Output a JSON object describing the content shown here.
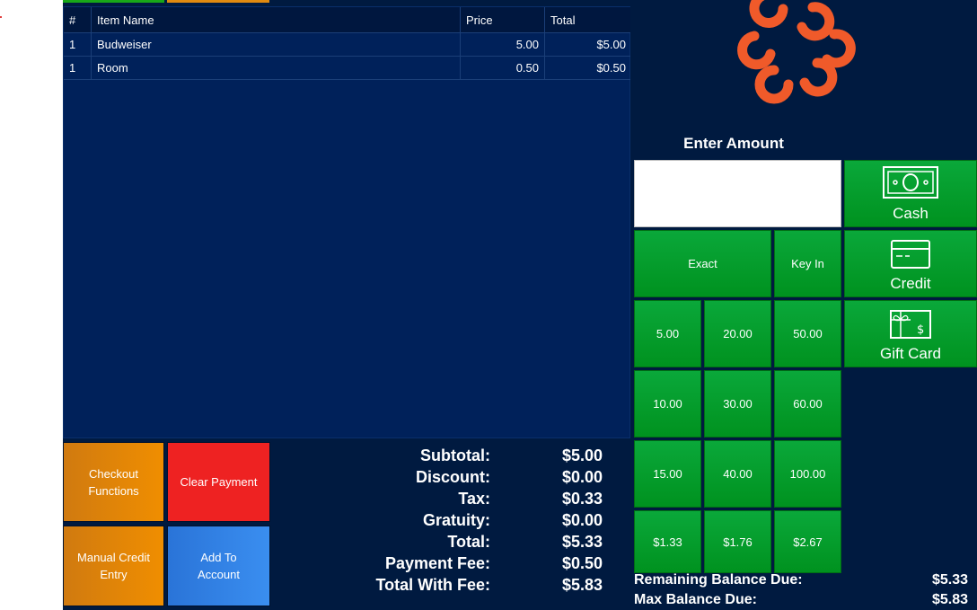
{
  "grid": {
    "headers": [
      "#",
      "Item Name",
      "Price",
      "Total"
    ],
    "rows": [
      {
        "qty": "1",
        "name": "Budweiser",
        "price": "5.00",
        "total": "$5.00"
      },
      {
        "qty": "1",
        "name": "Room",
        "price": "0.50",
        "total": "$0.50"
      }
    ]
  },
  "actions": {
    "checkout": "Checkout Functions",
    "clear": "Clear Payment",
    "manual_credit": "Manual Credit Entry",
    "add_account": "Add To Account"
  },
  "totals": [
    {
      "label": "Subtotal:",
      "value": "$5.00"
    },
    {
      "label": "Discount:",
      "value": "$0.00"
    },
    {
      "label": "Tax:",
      "value": "$0.33"
    },
    {
      "label": "Gratuity:",
      "value": "$0.00"
    },
    {
      "label": "Total:",
      "value": "$5.33"
    },
    {
      "label": "Payment Fee:",
      "value": "$0.50"
    },
    {
      "label": "Total With Fee:",
      "value": "$5.83"
    }
  ],
  "payment": {
    "enter_amount": "Enter Amount",
    "amount_value": "",
    "exact": "Exact",
    "key_in": "Key In",
    "keys": [
      "5.00",
      "20.00",
      "50.00",
      "10.00",
      "30.00",
      "60.00",
      "15.00",
      "40.00",
      "100.00",
      "$1.33",
      "$1.76",
      "$2.67"
    ],
    "cash": "Cash",
    "credit": "Credit",
    "gift_card": "Gift Card"
  },
  "balance": {
    "remaining_label": "Remaining Balance Due:",
    "remaining_value": "$5.33",
    "max_label": "Max Balance Due:",
    "max_value": "$5.83"
  },
  "colors": {
    "background": "#001a40",
    "grid": "#00215a",
    "green": "#00921f",
    "orange": "#f08e00",
    "red": "#ee2222",
    "blue": "#3a8ef0",
    "logo": "#f05a2a"
  }
}
